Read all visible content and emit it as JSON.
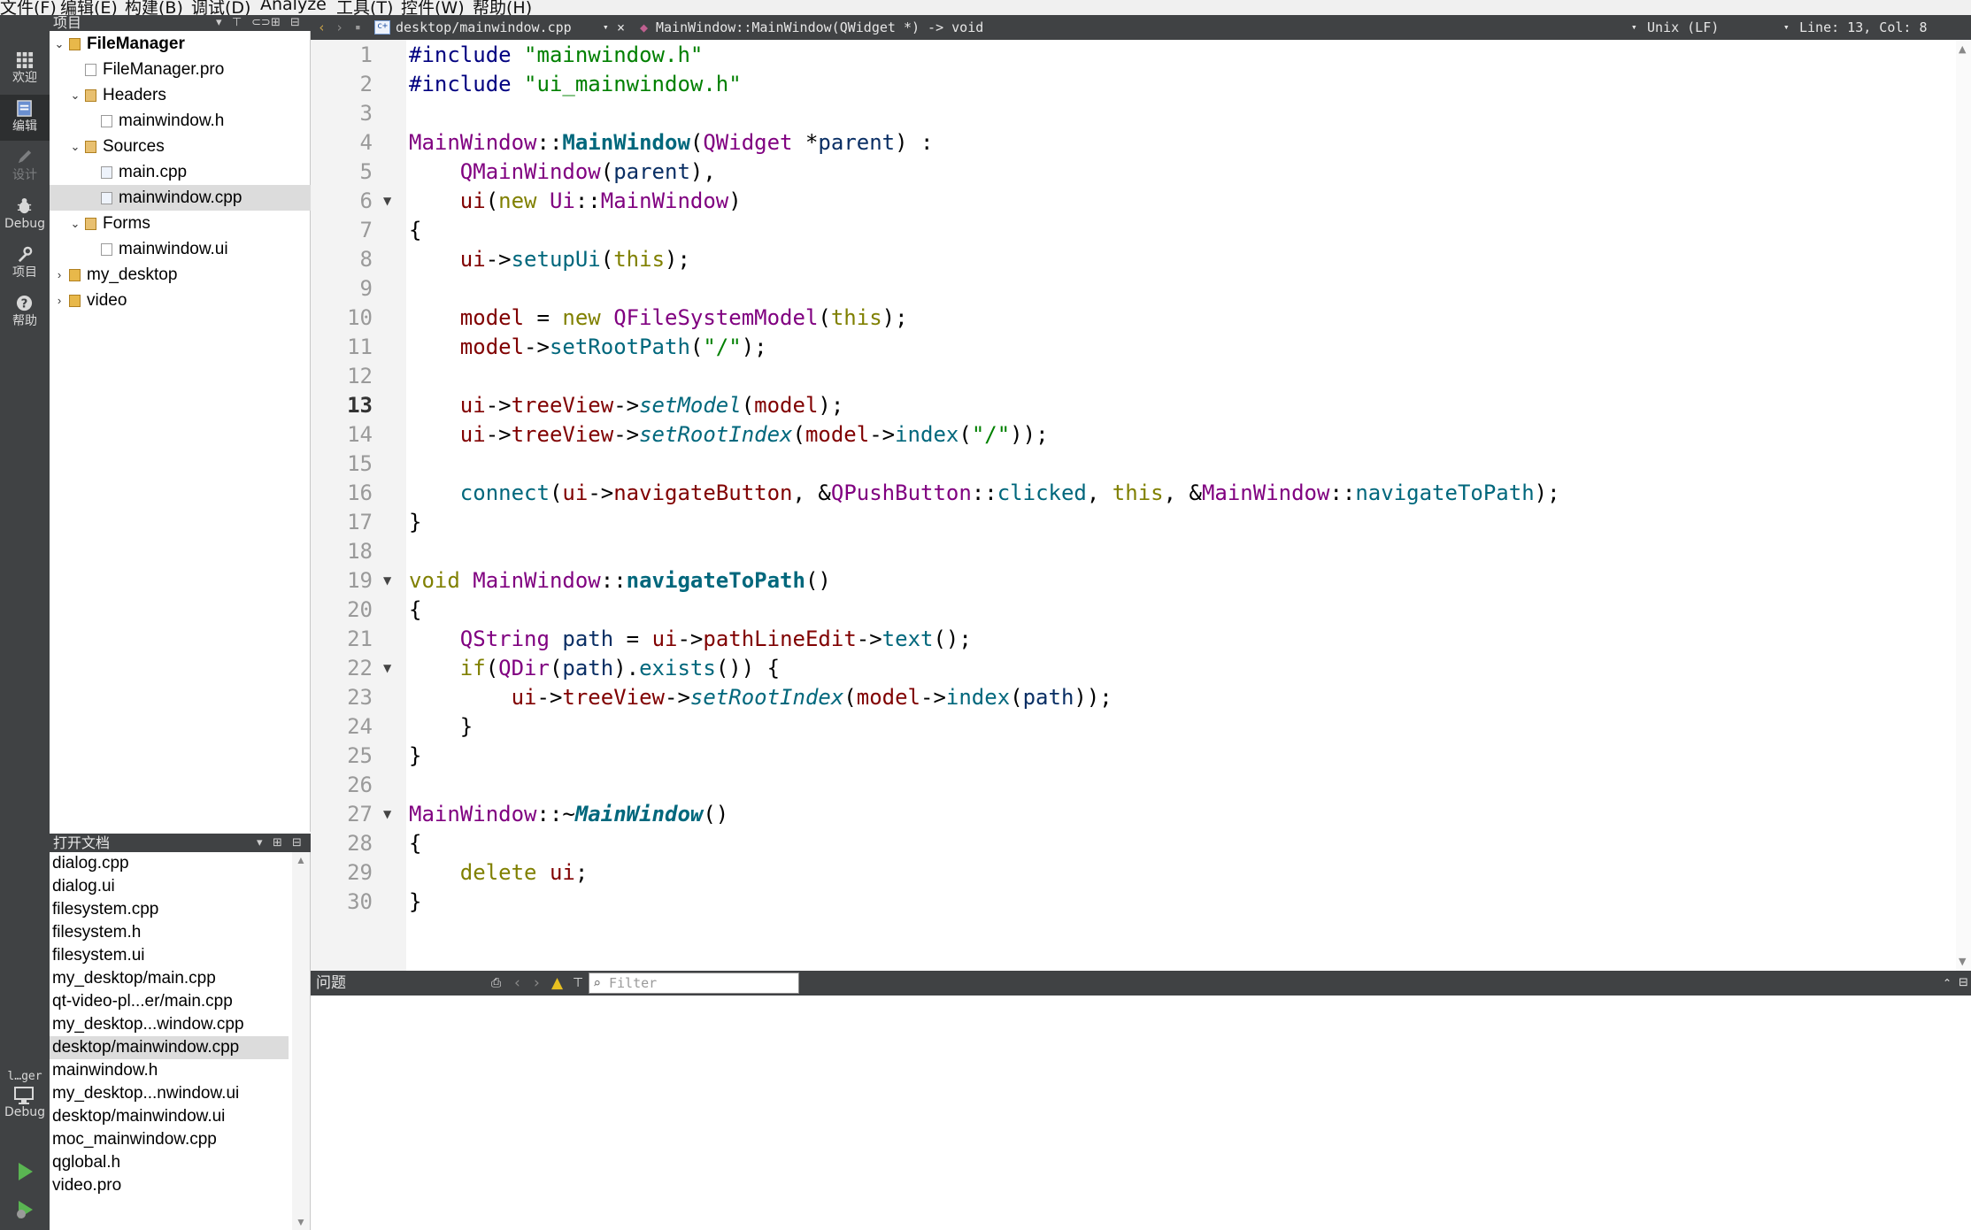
{
  "menubar": {
    "items": [
      "文件(F)",
      "编辑(E)",
      "构建(B)",
      "调试(D)",
      "Analyze",
      "工具(T)",
      "控件(W)",
      "帮助(H)"
    ]
  },
  "modebar": {
    "modes": [
      {
        "label": "欢迎",
        "icon": "grid-icon"
      },
      {
        "label": "编辑",
        "icon": "edit-document-icon"
      },
      {
        "label": "设计",
        "icon": "pencil-icon"
      },
      {
        "label": "Debug",
        "icon": "bug-icon"
      },
      {
        "label": "项目",
        "icon": "wrench-icon"
      },
      {
        "label": "帮助",
        "icon": "help-icon"
      }
    ],
    "kit_label": "l…ger",
    "kit_mode_label": "Debug",
    "run_icon": "run-icon",
    "debug_run_icon": "debug-run-icon"
  },
  "project_pane": {
    "title": "项目",
    "tree": [
      {
        "label": "FileManager",
        "level": 0,
        "arrow": "down",
        "icon": "project-folder-icon",
        "bold": true
      },
      {
        "label": "FileManager.pro",
        "level": 1,
        "arrow": "",
        "icon": "pro-file-icon"
      },
      {
        "label": "Headers",
        "level": 1,
        "arrow": "down",
        "icon": "folder-icon"
      },
      {
        "label": "mainwindow.h",
        "level": 2,
        "arrow": "",
        "icon": "header-file-icon"
      },
      {
        "label": "Sources",
        "level": 1,
        "arrow": "down",
        "icon": "folder-icon"
      },
      {
        "label": "main.cpp",
        "level": 2,
        "arrow": "",
        "icon": "cpp-file-icon"
      },
      {
        "label": "mainwindow.cpp",
        "level": 2,
        "arrow": "",
        "icon": "cpp-file-icon",
        "selected": true
      },
      {
        "label": "Forms",
        "level": 1,
        "arrow": "down",
        "icon": "folder-icon"
      },
      {
        "label": "mainwindow.ui",
        "level": 2,
        "arrow": "",
        "icon": "ui-file-icon"
      },
      {
        "label": "my_desktop",
        "level": 0,
        "arrow": "right",
        "icon": "project-folder-icon"
      },
      {
        "label": "video",
        "level": 0,
        "arrow": "right",
        "icon": "project-folder-icon"
      }
    ]
  },
  "open_docs": {
    "title": "打开文档",
    "items": [
      {
        "label": "dialog.cpp"
      },
      {
        "label": "dialog.ui"
      },
      {
        "label": "filesystem.cpp"
      },
      {
        "label": "filesystem.h"
      },
      {
        "label": "filesystem.ui"
      },
      {
        "label": "my_desktop/main.cpp"
      },
      {
        "label": "qt-video-pl...er/main.cpp"
      },
      {
        "label": "my_desktop...window.cpp"
      },
      {
        "label": "desktop/mainwindow.cpp",
        "selected": true
      },
      {
        "label": "mainwindow.h"
      },
      {
        "label": "my_desktop...nwindow.ui"
      },
      {
        "label": "desktop/mainwindow.ui"
      },
      {
        "label": "moc_mainwindow.cpp"
      },
      {
        "label": "qglobal.h"
      },
      {
        "label": "video.pro"
      }
    ]
  },
  "editor_toolbar": {
    "file_path": "desktop/mainwindow.cpp",
    "symbol": "MainWindow::MainWindow(QWidget *) -> void",
    "line_ending": "Unix (LF)",
    "cursor": "Line: 13, Col: 8"
  },
  "editor": {
    "current_line": 13,
    "fold_lines": [
      6,
      19,
      22,
      27
    ],
    "lines": [
      [
        [
          "#include ",
          "pp"
        ],
        [
          "\"mainwindow.h\"",
          "str"
        ]
      ],
      [
        [
          "#include ",
          "pp"
        ],
        [
          "\"ui_mainwindow.h\"",
          "str"
        ]
      ],
      [],
      [
        [
          "MainWindow",
          "cls"
        ],
        [
          "::",
          "op"
        ],
        [
          "MainWindow",
          "fdef"
        ],
        [
          "(",
          "op"
        ],
        [
          "QWidget",
          "cls"
        ],
        [
          " *",
          "op"
        ],
        [
          "parent",
          "loc"
        ],
        [
          ") :",
          "op"
        ]
      ],
      [
        [
          "    ",
          "op"
        ],
        [
          "QMainWindow",
          "cls"
        ],
        [
          "(",
          "op"
        ],
        [
          "parent",
          "loc"
        ],
        [
          "),",
          "op"
        ]
      ],
      [
        [
          "    ",
          "op"
        ],
        [
          "ui",
          "mem"
        ],
        [
          "(",
          "op"
        ],
        [
          "new ",
          "kw"
        ],
        [
          "Ui",
          "cls"
        ],
        [
          "::",
          "op"
        ],
        [
          "MainWindow",
          "cls"
        ],
        [
          ")",
          "op"
        ]
      ],
      [
        [
          "{",
          "op"
        ]
      ],
      [
        [
          "    ",
          "op"
        ],
        [
          "ui",
          "mem"
        ],
        [
          "->",
          "op"
        ],
        [
          "setupUi",
          "func"
        ],
        [
          "(",
          "op"
        ],
        [
          "this",
          "kw"
        ],
        [
          ");",
          "op"
        ]
      ],
      [],
      [
        [
          "    ",
          "op"
        ],
        [
          "model",
          "mem"
        ],
        [
          " = ",
          "op"
        ],
        [
          "new ",
          "kw"
        ],
        [
          "QFileSystemModel",
          "cls"
        ],
        [
          "(",
          "op"
        ],
        [
          "this",
          "kw"
        ],
        [
          ");",
          "op"
        ]
      ],
      [
        [
          "    ",
          "op"
        ],
        [
          "model",
          "mem"
        ],
        [
          "->",
          "op"
        ],
        [
          "setRootPath",
          "func"
        ],
        [
          "(",
          "op"
        ],
        [
          "\"/\"",
          "str"
        ],
        [
          ");",
          "op"
        ]
      ],
      [],
      [
        [
          "    ",
          "op"
        ],
        [
          "ui",
          "mem"
        ],
        [
          "->",
          "op"
        ],
        [
          "treeView",
          "mem"
        ],
        [
          "->",
          "op"
        ],
        [
          "setModel",
          "virt"
        ],
        [
          "(",
          "op"
        ],
        [
          "model",
          "mem"
        ],
        [
          ");",
          "op"
        ]
      ],
      [
        [
          "    ",
          "op"
        ],
        [
          "ui",
          "mem"
        ],
        [
          "->",
          "op"
        ],
        [
          "treeView",
          "mem"
        ],
        [
          "->",
          "op"
        ],
        [
          "setRootIndex",
          "virt"
        ],
        [
          "(",
          "op"
        ],
        [
          "model",
          "mem"
        ],
        [
          "->",
          "op"
        ],
        [
          "index",
          "func"
        ],
        [
          "(",
          "op"
        ],
        [
          "\"/\"",
          "str"
        ],
        [
          "));",
          "op"
        ]
      ],
      [],
      [
        [
          "    ",
          "op"
        ],
        [
          "connect",
          "func"
        ],
        [
          "(",
          "op"
        ],
        [
          "ui",
          "mem"
        ],
        [
          "->",
          "op"
        ],
        [
          "navigateButton",
          "mem"
        ],
        [
          ", &",
          "op"
        ],
        [
          "QPushButton",
          "cls"
        ],
        [
          "::",
          "op"
        ],
        [
          "clicked",
          "func"
        ],
        [
          ", ",
          "op"
        ],
        [
          "this",
          "kw"
        ],
        [
          ", &",
          "op"
        ],
        [
          "MainWindow",
          "cls"
        ],
        [
          "::",
          "op"
        ],
        [
          "navigateToPath",
          "func"
        ],
        [
          ");",
          "op"
        ]
      ],
      [
        [
          "}",
          "op"
        ]
      ],
      [],
      [
        [
          "void ",
          "kw"
        ],
        [
          "MainWindow",
          "cls"
        ],
        [
          "::",
          "op"
        ],
        [
          "navigateToPath",
          "fdef"
        ],
        [
          "()",
          "op"
        ]
      ],
      [
        [
          "{",
          "op"
        ]
      ],
      [
        [
          "    ",
          "op"
        ],
        [
          "QString",
          "cls"
        ],
        [
          " ",
          "op"
        ],
        [
          "path",
          "loc"
        ],
        [
          " = ",
          "op"
        ],
        [
          "ui",
          "mem"
        ],
        [
          "->",
          "op"
        ],
        [
          "pathLineEdit",
          "mem"
        ],
        [
          "->",
          "op"
        ],
        [
          "text",
          "func"
        ],
        [
          "();",
          "op"
        ]
      ],
      [
        [
          "    ",
          "op"
        ],
        [
          "if",
          "kw"
        ],
        [
          "(",
          "op"
        ],
        [
          "QDir",
          "cls"
        ],
        [
          "(",
          "op"
        ],
        [
          "path",
          "loc"
        ],
        [
          ").",
          "op"
        ],
        [
          "exists",
          "func"
        ],
        [
          "()) {",
          "op"
        ]
      ],
      [
        [
          "        ",
          "op"
        ],
        [
          "ui",
          "mem"
        ],
        [
          "->",
          "op"
        ],
        [
          "treeView",
          "mem"
        ],
        [
          "->",
          "op"
        ],
        [
          "setRootIndex",
          "virt"
        ],
        [
          "(",
          "op"
        ],
        [
          "model",
          "mem"
        ],
        [
          "->",
          "op"
        ],
        [
          "index",
          "func"
        ],
        [
          "(",
          "op"
        ],
        [
          "path",
          "loc"
        ],
        [
          "));",
          "op"
        ]
      ],
      [
        [
          "    }",
          "op"
        ]
      ],
      [
        [
          "}",
          "op"
        ]
      ],
      [],
      [
        [
          "MainWindow",
          "cls"
        ],
        [
          "::~",
          "op"
        ],
        [
          "MainWindow",
          "dtor"
        ],
        [
          "()",
          "op"
        ]
      ],
      [
        [
          "{",
          "op"
        ]
      ],
      [
        [
          "    ",
          "op"
        ],
        [
          "delete ",
          "kw"
        ],
        [
          "ui",
          "mem"
        ],
        [
          ";",
          "op"
        ]
      ],
      [
        [
          "}",
          "op"
        ]
      ]
    ]
  },
  "issues_pane": {
    "title": "问题",
    "filter_placeholder": "Filter"
  }
}
